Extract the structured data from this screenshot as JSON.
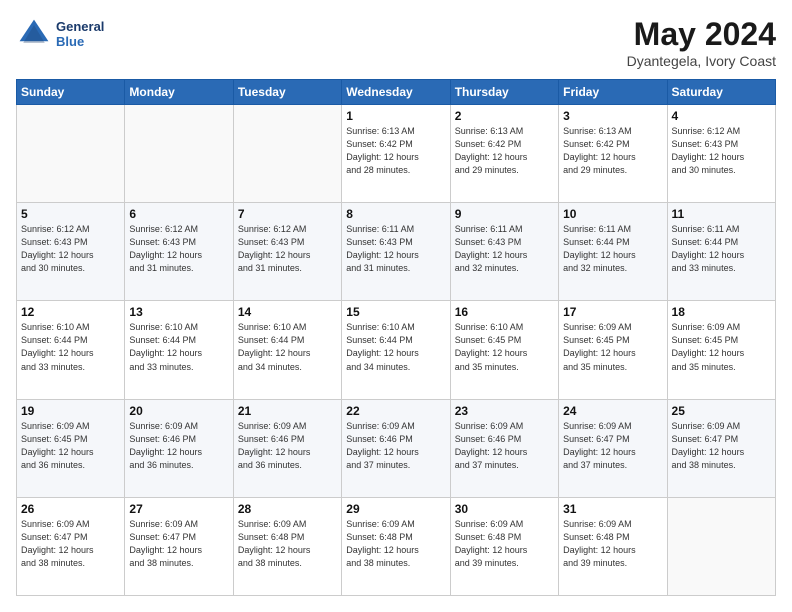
{
  "header": {
    "logo_line1": "General",
    "logo_line2": "Blue",
    "month_year": "May 2024",
    "location": "Dyantegela, Ivory Coast"
  },
  "days_of_week": [
    "Sunday",
    "Monday",
    "Tuesday",
    "Wednesday",
    "Thursday",
    "Friday",
    "Saturday"
  ],
  "weeks": [
    [
      {
        "day": "",
        "info": ""
      },
      {
        "day": "",
        "info": ""
      },
      {
        "day": "",
        "info": ""
      },
      {
        "day": "1",
        "info": "Sunrise: 6:13 AM\nSunset: 6:42 PM\nDaylight: 12 hours\nand 28 minutes."
      },
      {
        "day": "2",
        "info": "Sunrise: 6:13 AM\nSunset: 6:42 PM\nDaylight: 12 hours\nand 29 minutes."
      },
      {
        "day": "3",
        "info": "Sunrise: 6:13 AM\nSunset: 6:42 PM\nDaylight: 12 hours\nand 29 minutes."
      },
      {
        "day": "4",
        "info": "Sunrise: 6:12 AM\nSunset: 6:43 PM\nDaylight: 12 hours\nand 30 minutes."
      }
    ],
    [
      {
        "day": "5",
        "info": "Sunrise: 6:12 AM\nSunset: 6:43 PM\nDaylight: 12 hours\nand 30 minutes."
      },
      {
        "day": "6",
        "info": "Sunrise: 6:12 AM\nSunset: 6:43 PM\nDaylight: 12 hours\nand 31 minutes."
      },
      {
        "day": "7",
        "info": "Sunrise: 6:12 AM\nSunset: 6:43 PM\nDaylight: 12 hours\nand 31 minutes."
      },
      {
        "day": "8",
        "info": "Sunrise: 6:11 AM\nSunset: 6:43 PM\nDaylight: 12 hours\nand 31 minutes."
      },
      {
        "day": "9",
        "info": "Sunrise: 6:11 AM\nSunset: 6:43 PM\nDaylight: 12 hours\nand 32 minutes."
      },
      {
        "day": "10",
        "info": "Sunrise: 6:11 AM\nSunset: 6:44 PM\nDaylight: 12 hours\nand 32 minutes."
      },
      {
        "day": "11",
        "info": "Sunrise: 6:11 AM\nSunset: 6:44 PM\nDaylight: 12 hours\nand 33 minutes."
      }
    ],
    [
      {
        "day": "12",
        "info": "Sunrise: 6:10 AM\nSunset: 6:44 PM\nDaylight: 12 hours\nand 33 minutes."
      },
      {
        "day": "13",
        "info": "Sunrise: 6:10 AM\nSunset: 6:44 PM\nDaylight: 12 hours\nand 33 minutes."
      },
      {
        "day": "14",
        "info": "Sunrise: 6:10 AM\nSunset: 6:44 PM\nDaylight: 12 hours\nand 34 minutes."
      },
      {
        "day": "15",
        "info": "Sunrise: 6:10 AM\nSunset: 6:44 PM\nDaylight: 12 hours\nand 34 minutes."
      },
      {
        "day": "16",
        "info": "Sunrise: 6:10 AM\nSunset: 6:45 PM\nDaylight: 12 hours\nand 35 minutes."
      },
      {
        "day": "17",
        "info": "Sunrise: 6:09 AM\nSunset: 6:45 PM\nDaylight: 12 hours\nand 35 minutes."
      },
      {
        "day": "18",
        "info": "Sunrise: 6:09 AM\nSunset: 6:45 PM\nDaylight: 12 hours\nand 35 minutes."
      }
    ],
    [
      {
        "day": "19",
        "info": "Sunrise: 6:09 AM\nSunset: 6:45 PM\nDaylight: 12 hours\nand 36 minutes."
      },
      {
        "day": "20",
        "info": "Sunrise: 6:09 AM\nSunset: 6:46 PM\nDaylight: 12 hours\nand 36 minutes."
      },
      {
        "day": "21",
        "info": "Sunrise: 6:09 AM\nSunset: 6:46 PM\nDaylight: 12 hours\nand 36 minutes."
      },
      {
        "day": "22",
        "info": "Sunrise: 6:09 AM\nSunset: 6:46 PM\nDaylight: 12 hours\nand 37 minutes."
      },
      {
        "day": "23",
        "info": "Sunrise: 6:09 AM\nSunset: 6:46 PM\nDaylight: 12 hours\nand 37 minutes."
      },
      {
        "day": "24",
        "info": "Sunrise: 6:09 AM\nSunset: 6:47 PM\nDaylight: 12 hours\nand 37 minutes."
      },
      {
        "day": "25",
        "info": "Sunrise: 6:09 AM\nSunset: 6:47 PM\nDaylight: 12 hours\nand 38 minutes."
      }
    ],
    [
      {
        "day": "26",
        "info": "Sunrise: 6:09 AM\nSunset: 6:47 PM\nDaylight: 12 hours\nand 38 minutes."
      },
      {
        "day": "27",
        "info": "Sunrise: 6:09 AM\nSunset: 6:47 PM\nDaylight: 12 hours\nand 38 minutes."
      },
      {
        "day": "28",
        "info": "Sunrise: 6:09 AM\nSunset: 6:48 PM\nDaylight: 12 hours\nand 38 minutes."
      },
      {
        "day": "29",
        "info": "Sunrise: 6:09 AM\nSunset: 6:48 PM\nDaylight: 12 hours\nand 38 minutes."
      },
      {
        "day": "30",
        "info": "Sunrise: 6:09 AM\nSunset: 6:48 PM\nDaylight: 12 hours\nand 39 minutes."
      },
      {
        "day": "31",
        "info": "Sunrise: 6:09 AM\nSunset: 6:48 PM\nDaylight: 12 hours\nand 39 minutes."
      },
      {
        "day": "",
        "info": ""
      }
    ]
  ]
}
